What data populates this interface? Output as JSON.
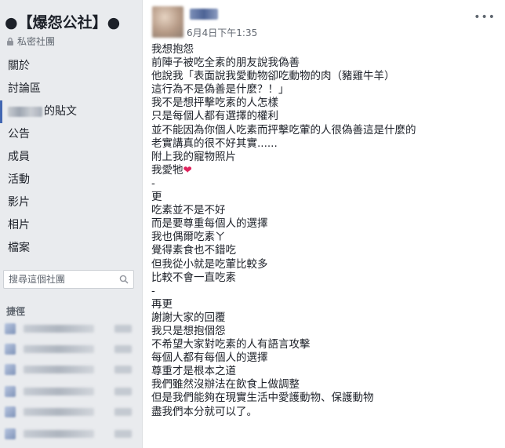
{
  "sidebar": {
    "group_title": "●【爆怨公社】●",
    "privacy_label": "私密社團",
    "nav": {
      "about": "關於",
      "discussion": "討論區",
      "member_posts_suffix": "的貼文",
      "announcements": "公告",
      "members": "成員",
      "events": "活動",
      "videos": "影片",
      "photos": "相片",
      "files": "檔案"
    },
    "search_placeholder": "搜尋這個社團",
    "shortcuts_label": "捷徑"
  },
  "post": {
    "timestamp": "6月4日下午1:35",
    "menu_icon": "•••",
    "lines": [
      "我想抱怨",
      "前陣子被吃全素的朋友說我偽善",
      "他說我「表面說我愛動物卻吃動物的肉（豬雞牛羊）",
      "這行為不是偽善是什麼？！」",
      "我不是想抨擊吃素的人怎樣",
      "只是每個人都有選擇的權利",
      "並不能因為你個人吃素而抨擊吃葷的人很偽善這是什麼的",
      "老實講真的很不好其實......",
      "附上我的寵物照片",
      "我愛牠",
      "-",
      "更",
      "吃素並不是不好",
      "而是要尊重每個人的選擇",
      "我也偶爾吃素ㄚ",
      "覺得素食也不錯吃",
      "但我從小就是吃葷比較多",
      "比較不會一直吃素",
      "-",
      "再更",
      "謝謝大家的回覆",
      "我只是想抱個怨",
      "不希望大家對吃素的人有語言攻擊",
      "每個人都有每個人的選擇",
      "尊重才是根本之道",
      "我們雖然沒辦法在飲食上做調整",
      "但是我們能夠在現實生活中愛護動物、保護動物",
      "盡我們本分就可以了。"
    ],
    "heart_icon": "❤"
  }
}
